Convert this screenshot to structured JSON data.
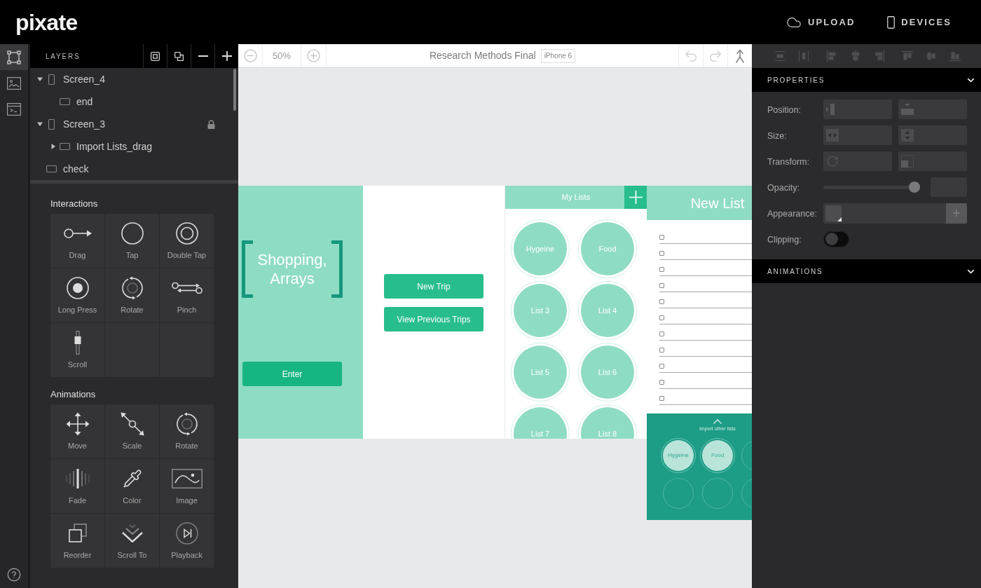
{
  "header": {
    "logo": "pixate",
    "actions": [
      {
        "kind": "upload",
        "label": "UPLOAD"
      },
      {
        "kind": "devices",
        "label": "DEVICES"
      }
    ]
  },
  "left_rail": [
    {
      "kind": "layers",
      "selected": true
    },
    {
      "kind": "assets",
      "selected": false
    },
    {
      "kind": "code",
      "selected": false
    }
  ],
  "layers_panel": {
    "title": "LAYERS",
    "items": [
      {
        "kind": "screen",
        "name": "Screen_4",
        "expanded": true,
        "children": [
          {
            "kind": "layer",
            "name": "end"
          }
        ]
      },
      {
        "kind": "screen",
        "name": "Screen_3",
        "expanded": true,
        "locked": true,
        "children": [
          {
            "kind": "layer",
            "name": "Import Lists_drag",
            "expanded": false
          }
        ]
      },
      {
        "kind": "layer",
        "name": "check"
      }
    ]
  },
  "interactions": {
    "title": "Interactions",
    "items": [
      {
        "kind": "drag",
        "label": "Drag"
      },
      {
        "kind": "tap",
        "label": "Tap"
      },
      {
        "kind": "double_tap",
        "label": "Double Tap"
      },
      {
        "kind": "long_press",
        "label": "Long Press"
      },
      {
        "kind": "rotate",
        "label": "Rotate"
      },
      {
        "kind": "pinch",
        "label": "Pinch"
      },
      {
        "kind": "scroll",
        "label": "Scroll"
      }
    ]
  },
  "animations": {
    "title": "Animations",
    "items": [
      {
        "kind": "move",
        "label": "Move"
      },
      {
        "kind": "scale",
        "label": "Scale"
      },
      {
        "kind": "rotate",
        "label": "Rotate"
      },
      {
        "kind": "fade",
        "label": "Fade"
      },
      {
        "kind": "color",
        "label": "Color"
      },
      {
        "kind": "image",
        "label": "Image"
      },
      {
        "kind": "reorder",
        "label": "Reorder"
      },
      {
        "kind": "scroll_to",
        "label": "Scroll To"
      },
      {
        "kind": "playback",
        "label": "Playback"
      }
    ]
  },
  "canvas": {
    "zoom": "50%",
    "title": "Research Methods Final",
    "device": "iPhone 6",
    "history": [
      {
        "kind": "undo",
        "disabled": true
      },
      {
        "kind": "redo",
        "disabled": true
      },
      {
        "kind": "merge",
        "disabled": false
      }
    ],
    "screens": [
      {
        "kind": "splash",
        "title": "Shopping, Arrays",
        "button": "Enter"
      },
      {
        "kind": "menu",
        "buttons": [
          "New Trip",
          "View Previous Trips"
        ]
      },
      {
        "kind": "lists",
        "title": "My Lists",
        "lists": [
          "Hygeine",
          "Food",
          "List 3",
          "List 4",
          "List 5",
          "List 6",
          "List 7",
          "List 8"
        ]
      },
      {
        "kind": "new_list",
        "title": "New List",
        "items": [
          {
            "checked": false
          },
          {
            "checked": false
          },
          {
            "checked": false
          },
          {
            "checked": false
          },
          {
            "checked": false
          },
          {
            "checked": false
          },
          {
            "checked": false
          },
          {
            "checked": false
          },
          {
            "checked": false
          },
          {
            "checked": false
          },
          {
            "checked": false
          }
        ],
        "import_label": "import other lists",
        "import_lists": [
          "Hygeine",
          "Food"
        ]
      }
    ]
  },
  "align_toolbar": {
    "disabled": true
  },
  "properties": {
    "title": "PROPERTIES",
    "expanded": true,
    "rows": [
      {
        "kind": "position",
        "label": "Position:"
      },
      {
        "kind": "size",
        "label": "Size:"
      },
      {
        "kind": "transform",
        "label": "Transform:"
      },
      {
        "kind": "opacity",
        "label": "Opacity:",
        "level": 1
      },
      {
        "kind": "appearance",
        "label": "Appearance:"
      },
      {
        "kind": "clipping",
        "label": "Clipping:",
        "on": false
      }
    ]
  },
  "animations_section": {
    "title": "ANIMATIONS",
    "expanded": true
  }
}
